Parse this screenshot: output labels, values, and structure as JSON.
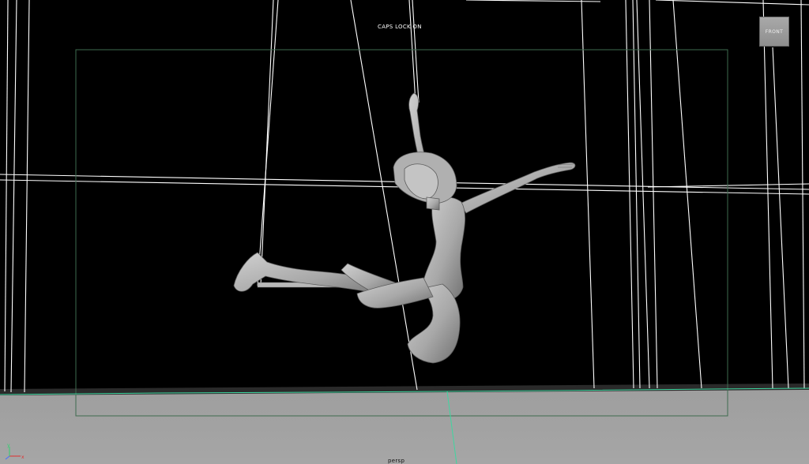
{
  "hud": {
    "caps_lock": "CAPS LOCK ON",
    "camera": "persp"
  },
  "view_cube": {
    "face_label": "FRONT"
  },
  "axis_indicator": {
    "x_label": "x",
    "y_label": "y"
  },
  "colors": {
    "background": "#000000",
    "ground_plane": "#a2a2a2",
    "wireframe": "#ffffff",
    "resolution_gate": "#3e6b4f",
    "selection_highlight": "#3fd6a0",
    "character_shading": "#b4b4b4",
    "view_cube": "#9c9c9c"
  }
}
